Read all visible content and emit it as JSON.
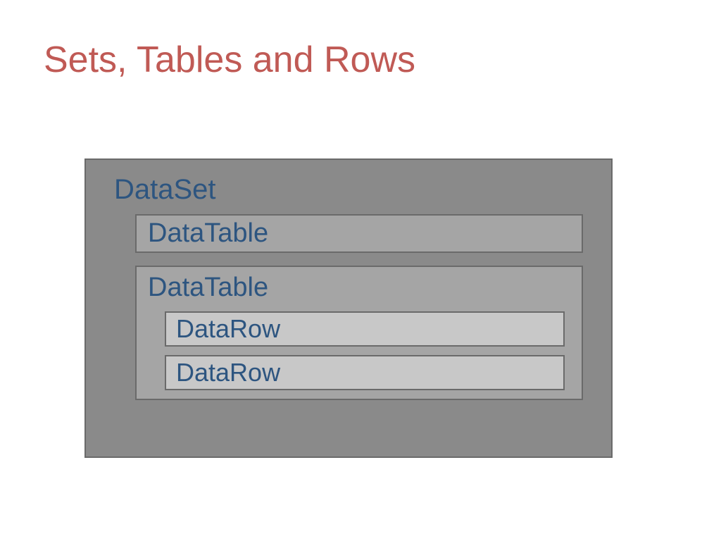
{
  "title": "Sets, Tables and Rows",
  "diagram": {
    "dataset": {
      "label": "DataSet",
      "tables": [
        {
          "label": "DataTable",
          "rows": []
        },
        {
          "label": "DataTable",
          "rows": [
            {
              "label": "DataRow"
            },
            {
              "label": "DataRow"
            }
          ]
        }
      ]
    }
  }
}
